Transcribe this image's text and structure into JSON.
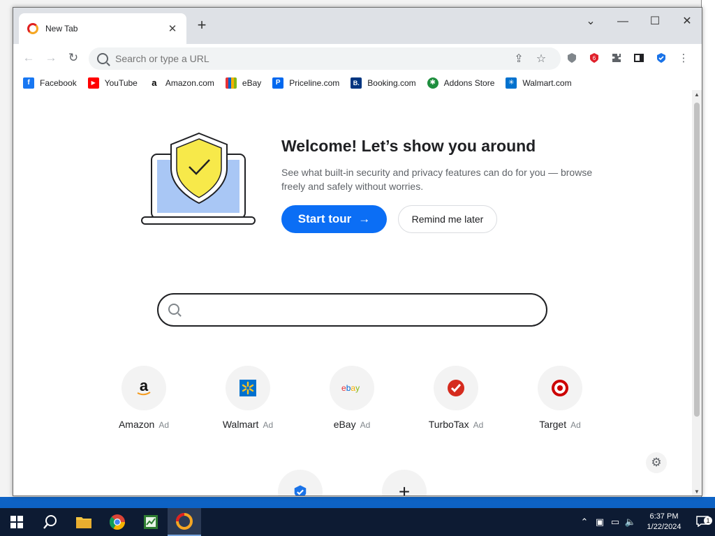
{
  "browser": {
    "tab_title": "New Tab",
    "omnibox_placeholder": "Search or type a URL"
  },
  "bookmarks": [
    {
      "label": "Facebook",
      "icon": "facebook-icon",
      "color": "#1877f2",
      "glyph": "f"
    },
    {
      "label": "YouTube",
      "icon": "youtube-icon",
      "color": "#ff0000",
      "glyph": "▶"
    },
    {
      "label": "Amazon.com",
      "icon": "amazon-icon",
      "color": "#ffffff",
      "glyph": "a"
    },
    {
      "label": "eBay",
      "icon": "ebay-icon",
      "color": "#e53238",
      "glyph": ""
    },
    {
      "label": "Priceline.com",
      "icon": "priceline-icon",
      "color": "#0068ef",
      "glyph": "P"
    },
    {
      "label": "Booking.com",
      "icon": "booking-icon",
      "color": "#003580",
      "glyph": "B."
    },
    {
      "label": "Addons Store",
      "icon": "addons-store-icon",
      "color": "#1e8e3e",
      "glyph": "✱"
    },
    {
      "label": "Walmart.com",
      "icon": "walmart-icon",
      "color": "#0071ce",
      "glyph": "✳"
    }
  ],
  "welcome": {
    "title": "Welcome! Let’s show you around",
    "description": "See what built-in security and privacy features can do for you — browse freely and safely without worries.",
    "start_tour_label": "Start tour",
    "remind_label": "Remind me later"
  },
  "tiles": [
    {
      "label": "Amazon",
      "ad": "Ad",
      "icon": "amazon-icon"
    },
    {
      "label": "Walmart",
      "ad": "Ad",
      "icon": "walmart-icon"
    },
    {
      "label": "eBay",
      "ad": "Ad",
      "icon": "ebay-icon"
    },
    {
      "label": "TurboTax",
      "ad": "Ad",
      "icon": "turbotax-icon"
    },
    {
      "label": "Target",
      "ad": "Ad",
      "icon": "target-icon"
    }
  ],
  "taskbar": {
    "time": "6:37 PM",
    "date": "1/22/2024",
    "notification_count": "1"
  },
  "colors": {
    "accent": "#0b6ef5",
    "shield_yellow": "#f7e94a",
    "laptop_screen": "#a9c7f5"
  }
}
